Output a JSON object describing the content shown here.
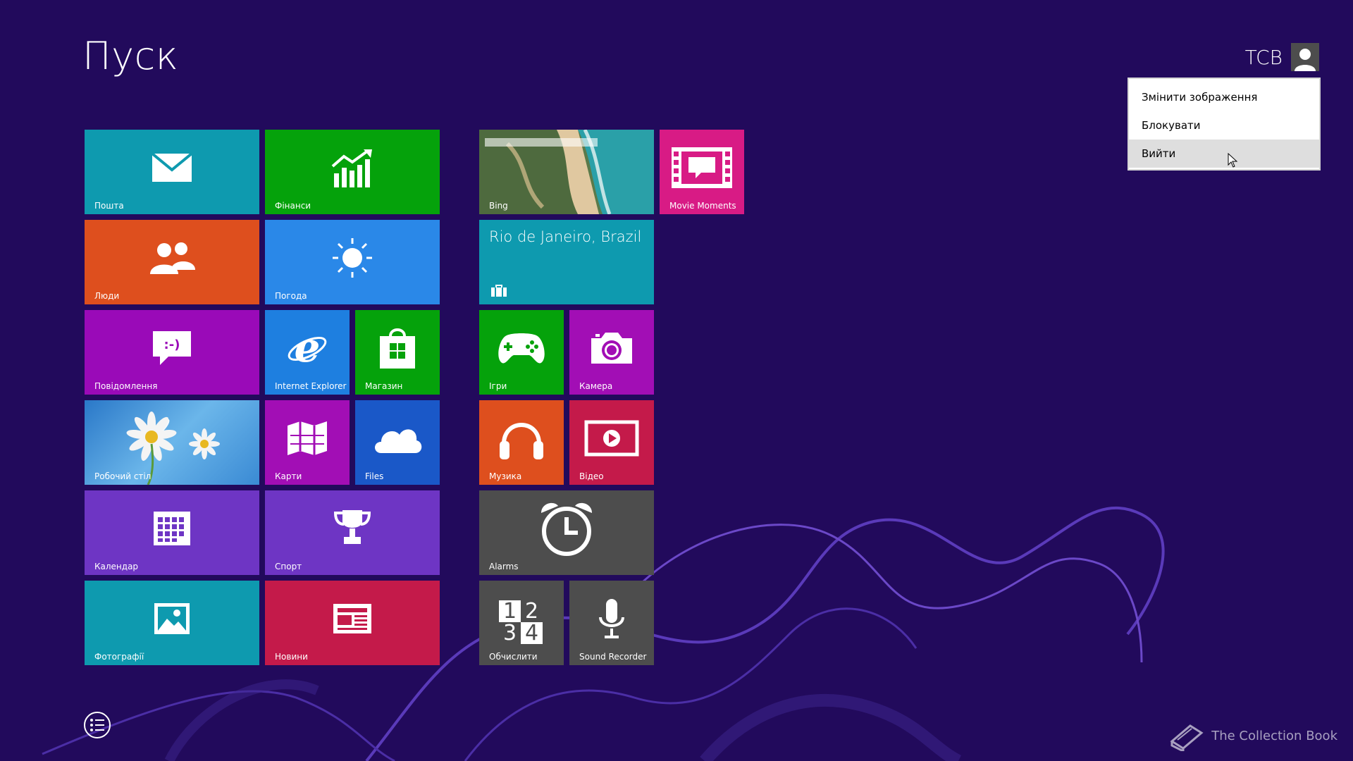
{
  "start": {
    "title": "Пуск"
  },
  "user": {
    "name": "TCB",
    "menu": [
      {
        "label": "Змінити зображення"
      },
      {
        "label": "Блокувати"
      },
      {
        "label": "Вийти"
      }
    ]
  },
  "tiles": {
    "mail": {
      "label": "Пошта",
      "color": "#0e9aaf",
      "icon": "mail-icon"
    },
    "finance": {
      "label": "Фінанси",
      "color": "#05a20b",
      "icon": "finance-chart-icon"
    },
    "people": {
      "label": "Люди",
      "color": "#de4f1e",
      "icon": "people-icon"
    },
    "weather": {
      "label": "Погода",
      "color": "#2a88e8",
      "icon": "sun-icon"
    },
    "messaging": {
      "label": "Повідомлення",
      "color": "#9a0ab8",
      "icon": "chat-icon"
    },
    "ie": {
      "label": "Internet Explorer",
      "color": "#1e7fe0",
      "icon": "internet-explorer-icon"
    },
    "store": {
      "label": "Магазин",
      "color": "#05a20b",
      "icon": "store-bag-icon"
    },
    "desktop": {
      "label": "Робочий стіл",
      "color": "#5aa6e0",
      "icon": "daisy-wallpaper"
    },
    "maps": {
      "label": "Карти",
      "color": "#a20eb5",
      "icon": "map-icon"
    },
    "files": {
      "label": "Files",
      "color": "#1a58c8",
      "icon": "cloud-icon"
    },
    "calendar": {
      "label": "Календар",
      "color": "#6e35c4",
      "icon": "calendar-icon"
    },
    "sport": {
      "label": "Спорт",
      "color": "#6e35c4",
      "icon": "trophy-icon"
    },
    "photos": {
      "label": "Фотографії",
      "color": "#0e9aaf",
      "icon": "photo-icon"
    },
    "news": {
      "label": "Новини",
      "color": "#c41a4a",
      "icon": "newspaper-icon"
    },
    "bing": {
      "label": "Bing",
      "color": "#3e8a7a",
      "icon": "beach-photo"
    },
    "movie": {
      "label": "Movie Moments",
      "color": "#d81b85",
      "icon": "movie-frame-icon"
    },
    "travel": {
      "label": "Rio de Janeiro, Brazil",
      "color": "#0e9aaf",
      "icon": "suitcase-icon"
    },
    "games": {
      "label": "Ігри",
      "color": "#05a20b",
      "icon": "gamepad-icon"
    },
    "camera": {
      "label": "Камера",
      "color": "#a20eb5",
      "icon": "camera-icon"
    },
    "music": {
      "label": "Музика",
      "color": "#de4f1e",
      "icon": "headphones-icon"
    },
    "video": {
      "label": "Відео",
      "color": "#c41a4a",
      "icon": "video-icon"
    },
    "alarms": {
      "label": "Alarms",
      "color": "#4d4d4d",
      "icon": "alarm-clock-icon"
    },
    "calc": {
      "label": "Обчислити",
      "color": "#4d4d4d",
      "icon": "calculator-icon"
    },
    "recorder": {
      "label": "Sound Recorder",
      "color": "#4d4d4d",
      "icon": "microphone-icon"
    }
  },
  "calc_digits": [
    "1",
    "2",
    "3",
    "4"
  ],
  "watermark": "The Collection Book"
}
